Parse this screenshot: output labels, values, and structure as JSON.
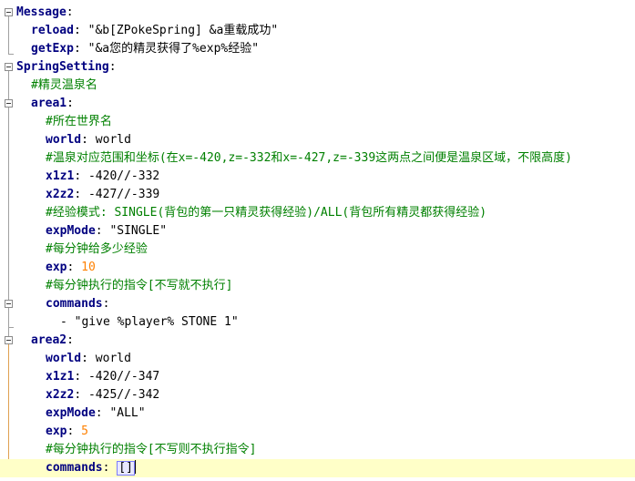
{
  "lines": [
    {
      "key": "Message",
      "sep": ":"
    },
    {
      "key": "reload",
      "sep": ": ",
      "value": "\"&b[ZPokeSpring] &a重载成功\""
    },
    {
      "key": "getExp",
      "sep": ": ",
      "value": "\"&a您的精灵获得了%exp%经验\""
    },
    {
      "key": "SpringSetting",
      "sep": ":"
    },
    {
      "comment": "#精灵温泉名"
    },
    {
      "key": "area1",
      "sep": ":"
    },
    {
      "comment": "#所在世界名"
    },
    {
      "key": "world",
      "sep": ": ",
      "value": "world"
    },
    {
      "comment": "#温泉对应范围和坐标(在x=-420,z=-332和x=-427,z=-339这两点之间便是温泉区域，不限高度)"
    },
    {
      "key": "x1z1",
      "sep": ": ",
      "value": "-420//-332"
    },
    {
      "key": "x2z2",
      "sep": ": ",
      "value": "-427//-339"
    },
    {
      "comment": "#经验模式: SINGLE(背包的第一只精灵获得经验)/ALL(背包所有精灵都获得经验)"
    },
    {
      "key": "expMode",
      "sep": ": ",
      "value": "\"SINGLE\""
    },
    {
      "comment": "#每分钟给多少经验"
    },
    {
      "key": "exp",
      "sep": ": ",
      "value": "10"
    },
    {
      "comment": "#每分钟执行的指令[不写就不执行]"
    },
    {
      "key": "commands",
      "sep": ":"
    },
    {
      "value": "- \"give %player% STONE 1\""
    },
    {
      "key": "area2",
      "sep": ":"
    },
    {
      "key": "world",
      "sep": ": ",
      "value": "world"
    },
    {
      "key": "x1z1",
      "sep": ": ",
      "value": "-420//-347"
    },
    {
      "key": "x2z2",
      "sep": ": ",
      "value": "-425//-342"
    },
    {
      "key": "expMode",
      "sep": ": ",
      "value": "\"ALL\""
    },
    {
      "key": "exp",
      "sep": ": ",
      "value": "5"
    },
    {
      "comment": "#每分钟执行的指令[不写则不执行指令]"
    },
    {
      "key": "commands",
      "sep": ": ",
      "value": "[]"
    }
  ],
  "colors": {
    "key": "#000080",
    "comment": "#008000",
    "number": "#ff8000",
    "current_line": "#ffffc8"
  }
}
